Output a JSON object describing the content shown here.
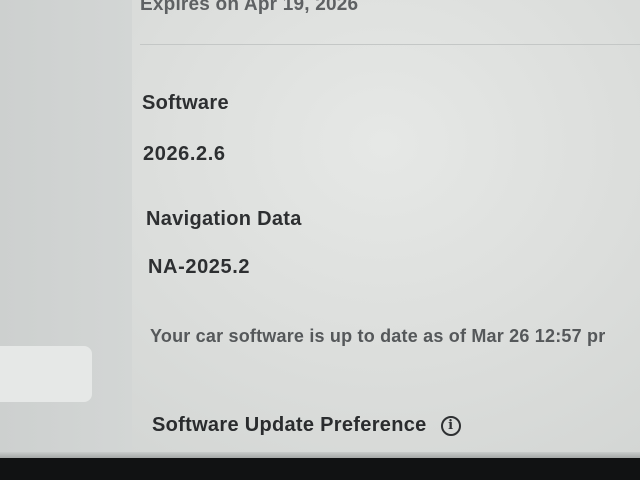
{
  "connectivity": {
    "expires_text": "Expires on Apr 19, 2026"
  },
  "software": {
    "label": "Software",
    "version": "2026.2.6"
  },
  "navigation_data": {
    "label": "Navigation Data",
    "version": "NA-2025.2"
  },
  "update_status": {
    "text": "Your car software is up to date as of Mar 26 12:57 pr"
  },
  "preference": {
    "label": "Software Update Preference",
    "icon": "info-icon"
  }
}
